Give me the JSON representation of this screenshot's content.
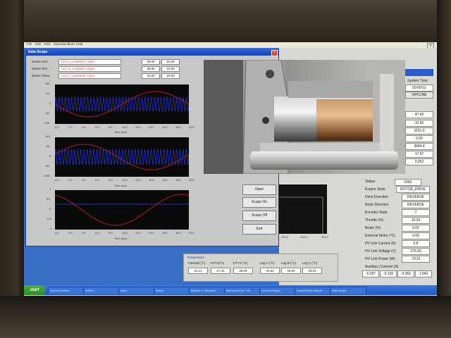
{
  "menubar": {
    "items": [
      "File",
      "Edit",
      "View",
      "Operations",
      "Tools",
      "Help"
    ]
  },
  "scope": {
    "title": "Data Scope",
    "series": [
      {
        "label": "Series One",
        "signal": "LEG_A_CURRENT_DATA",
        "v1": "48.00",
        "v2": "10.00"
      },
      {
        "label": "Series Two",
        "signal": "LEG_B_CURRENT_DATA",
        "v1": "48.00",
        "v2": "10.00"
      },
      {
        "label": "Series Three",
        "signal": "LEG_C_CURRENT_DATA",
        "v1": "44.00",
        "v2": "10.00"
      }
    ],
    "plot1_ticks": [
      "100",
      "50",
      "0",
      "-50",
      "-100"
    ],
    "plot1_rticks": [
      "1",
      "0.5",
      "0",
      "-0.5",
      "-1"
    ],
    "plot3_ticks": [
      "1",
      "0.5",
      "0",
      "-0.5",
      "-1"
    ],
    "xticks": [
      "0.0",
      "2.0",
      "4.0",
      "6.0",
      "8.0",
      "10.0",
      "12.0",
      "14.0",
      "16.0",
      "18.0",
      "20.0"
    ],
    "xlabel": "Time (ms)",
    "buttons": {
      "open": "Open",
      "scope_on": "Scope On",
      "scope_off": "Scope Off",
      "exit": "Exit"
    }
  },
  "right_panel": {
    "header_label": "System Time",
    "header_value": "00:00:01",
    "mode_value": "OFFLINE",
    "top_values": [
      "47.60",
      "10.50",
      "3151.6",
      "0.00",
      "3584.4",
      "17.97",
      "0.262"
    ],
    "small_plot_xticks": [
      "200.0",
      "250.0",
      "300.0"
    ],
    "status_label": "Status",
    "status_value": "2582",
    "rows": [
      {
        "label": "Engine State",
        "value": "ROTOR_DRIVE"
      },
      {
        "label": "Drive Direction",
        "value": "REVERSE"
      },
      {
        "label": "Rotor Direction",
        "value": "REVERSE"
      },
      {
        "label": "Encoder State",
        "value": "7"
      },
      {
        "label": "Throttle (%)",
        "value": "15.34"
      },
      {
        "label": "Brake (%)",
        "value": "0.02"
      },
      {
        "label": "External Motor (°C)",
        "value": "0.00"
      },
      {
        "label": "HV Link Current (A)",
        "value": "0.8"
      },
      {
        "label": "HV Link Voltage (V)",
        "value": "375.60"
      },
      {
        "label": "HV Link Power (W)",
        "value": "-2131"
      }
    ],
    "aux_label": "Auxiliary Currents (A)",
    "aux_values": [
      "-0.297",
      "-0.132",
      "-0.052",
      "1.042"
    ]
  },
  "temperature": {
    "title": "Temperature",
    "labels": [
      "Internal (°C)",
      "KTY1(°C)",
      "KTY2 (°C)",
      "Leg A (°C)",
      "Leg B (°C)",
      "Leg C (°C)"
    ],
    "values": [
      "31.12",
      "27.44",
      "28.04",
      "25.82",
      "25.65",
      "25.53"
    ]
  },
  "taskbar": {
    "start": "start",
    "tasks": [
      "Explorer Control",
      "WINNT",
      "Inbox",
      "Scope",
      "Blackbird - Microsoft...",
      "Microsoft Excel - Ro...",
      "Hot Line Project",
      "Local Electric Vehicle",
      "Data Scope"
    ]
  },
  "colors": {
    "trace_blue": "#2a3cff",
    "trace_red": "#c0202a",
    "titlebar": "#1a44b0",
    "taskbar": "#2456c0"
  }
}
